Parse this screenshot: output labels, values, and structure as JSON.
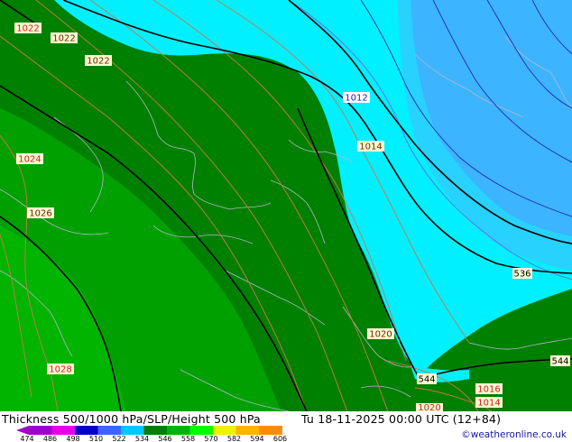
{
  "title": "Thickness 500/1000 hPa/SLP/Height 500 hPa",
  "datetime": "Tu 18-11-2025 00:00 UTC (12+84)",
  "credit": "©weatheronline.co.uk",
  "colorbar": {
    "ticks": [
      "474",
      "486",
      "498",
      "510",
      "522",
      "534",
      "546",
      "558",
      "570",
      "582",
      "594",
      "606"
    ],
    "colors": [
      "#a000c8",
      "#e600e6",
      "#0000c8",
      "#3c64ff",
      "#00c8ff",
      "#008000",
      "#00b400",
      "#00ff00",
      "#f0f000",
      "#ffb400",
      "#ff8c00"
    ]
  },
  "map": {
    "isobar_labels": [
      {
        "text": "1022",
        "color": "#c81e1e"
      },
      {
        "text": "1022",
        "color": "#6e1e00"
      },
      {
        "text": "1022",
        "color": "#6e1e00"
      },
      {
        "text": "1012",
        "color": "#1e1ec8"
      },
      {
        "text": "1014",
        "color": "#6e1e00"
      },
      {
        "text": "1024",
        "color": "#c81e1e"
      },
      {
        "text": "1026",
        "color": "#6e1e00"
      },
      {
        "text": "1028",
        "color": "#c81e1e"
      },
      {
        "text": "1020",
        "color": "#6e1e00"
      },
      {
        "text": "1016",
        "color": "#c81e1e"
      },
      {
        "text": "1014",
        "color": "#c81e1e"
      },
      {
        "text": "1020",
        "color": "#c81e1e"
      }
    ],
    "height_labels": [
      {
        "text": "536"
      },
      {
        "text": "544"
      },
      {
        "text": "544"
      }
    ]
  }
}
